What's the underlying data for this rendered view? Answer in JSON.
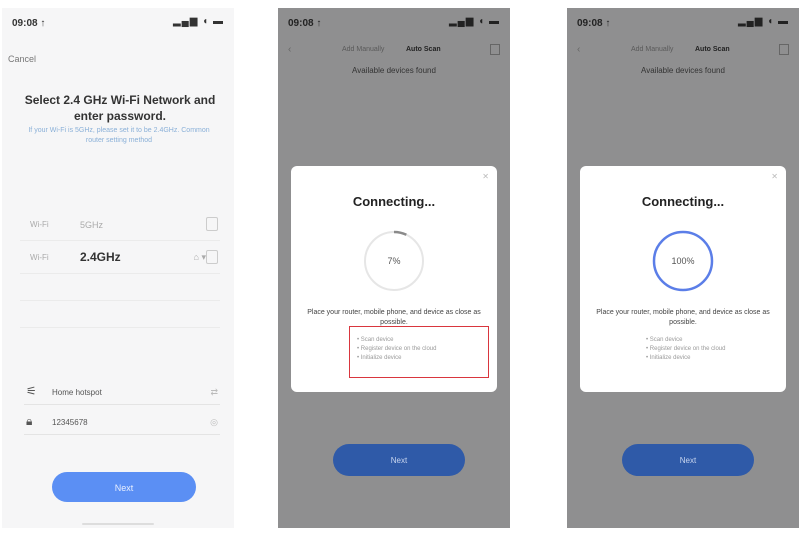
{
  "screen1": {
    "status": {
      "time": "09:08 ↑",
      "signal": "▂▄▆ ◖ ▬"
    },
    "cancel": "Cancel",
    "title": "Select 2.4 GHz Wi-Fi Network and enter password.",
    "hint": "If your Wi-Fi is 5GHz, please set it to be 2.4GHz. Common router setting method",
    "networks": [
      {
        "label": "Wi-Fi",
        "band": "5GHz",
        "bold": false
      },
      {
        "label": "Wi-Fi",
        "band": "2.4GHz",
        "bold": true
      }
    ],
    "wifi_name": "Home hotspot",
    "password": "12345678",
    "next": "Next"
  },
  "screen2": {
    "status": {
      "time": "09:08 ↑",
      "signal": "▂▄▆ ◖ ▬"
    },
    "nav": {
      "tab_auto": "Add Manually",
      "tab_scan": "Auto Scan"
    },
    "subtitle": "Available devices found",
    "modal": {
      "title": "Connecting...",
      "progress": 7,
      "progress_label": "7%",
      "message": "Place your router, mobile phone, and device as close as possible.",
      "tips": [
        "• Scan device",
        "• Register device on the cloud",
        "• Initialize device"
      ]
    },
    "next": "Next"
  },
  "screen3": {
    "status": {
      "time": "09:08 ↑",
      "signal": "▂▄▆ ◖ ▬"
    },
    "nav": {
      "tab_auto": "Add Manually",
      "tab_scan": "Auto Scan"
    },
    "subtitle": "Available devices found",
    "modal": {
      "title": "Connecting...",
      "progress": 100,
      "progress_label": "100%",
      "message": "Place your router, mobile phone, and device as close as possible.",
      "tips": [
        "• Scan device",
        "• Register device on the cloud",
        "• Initialize device"
      ]
    },
    "next": "Next"
  },
  "colors": {
    "accent": "#5b8ff4",
    "ring": "#5b7ee8",
    "highlight": "#d9363e"
  }
}
